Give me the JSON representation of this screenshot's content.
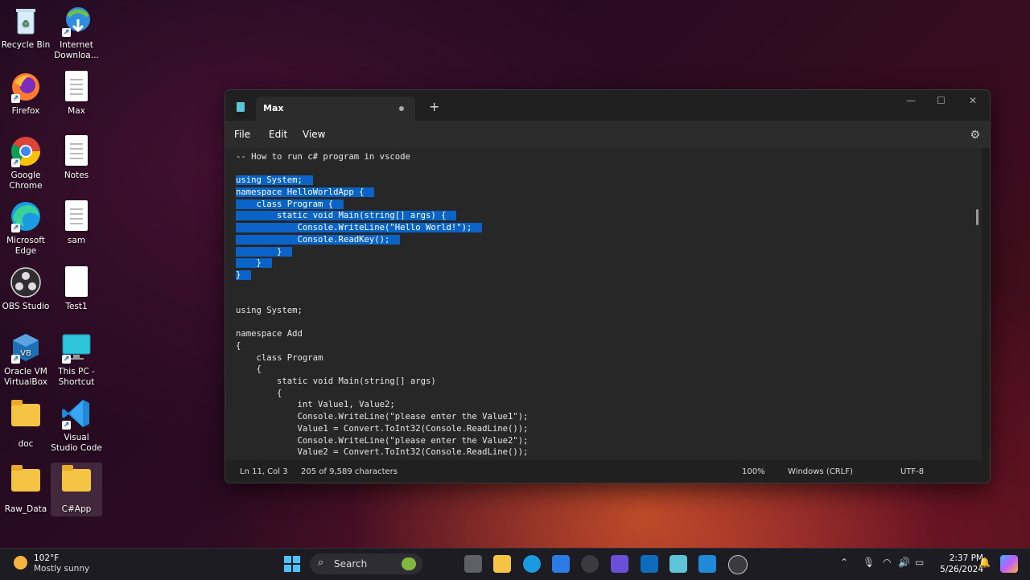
{
  "desktop": {
    "icons": [
      {
        "label": "Recycle Bin"
      },
      {
        "label": "Internet Downloa..."
      },
      {
        "label": "Firefox"
      },
      {
        "label": "Max"
      },
      {
        "label": "Google Chrome"
      },
      {
        "label": "Notes"
      },
      {
        "label": "Microsoft Edge"
      },
      {
        "label": "sam"
      },
      {
        "label": "OBS Studio"
      },
      {
        "label": "Test1"
      },
      {
        "label": "Oracle VM VirtualBox"
      },
      {
        "label": "This PC - Shortcut"
      },
      {
        "label": "doc"
      },
      {
        "label": "Visual Studio Code"
      },
      {
        "label": "Raw_Data"
      },
      {
        "label": "C#App"
      }
    ]
  },
  "notepad": {
    "tab_title": "Max",
    "new_tab": "+",
    "menu": {
      "file": "File",
      "edit": "Edit",
      "view": "View"
    },
    "lines": [
      "-- How to run c# program in vscode",
      "",
      "using System;",
      "namespace HelloWorldApp {",
      "    class Program {",
      "        static void Main(string[] args) {",
      "            Console.WriteLine(\"Hello World!\");",
      "            Console.ReadKey();",
      "        }",
      "    }",
      "}",
      "",
      "",
      "using System;",
      "",
      "namespace Add",
      "{",
      "    class Program",
      "    {",
      "        static void Main(string[] args)",
      "        {",
      "            int Value1, Value2;",
      "            Console.WriteLine(\"please enter the Value1\");",
      "            Value1 = Convert.ToInt32(Console.ReadLine());",
      "            Console.WriteLine(\"please enter the Value2\");",
      "            Value2 = Convert.ToInt32(Console.ReadLine());"
    ],
    "selected_lines": [
      2,
      3,
      4,
      5,
      6,
      7,
      8,
      9,
      10
    ],
    "status": {
      "position": "Ln 11, Col 3",
      "chars": "205 of 9,589 characters",
      "zoom": "100%",
      "line_ending": "Windows (CRLF)",
      "encoding": "UTF-8"
    }
  },
  "taskbar": {
    "weather_temp": "102°F",
    "weather_desc": "Mostly sunny",
    "search_label": "Search",
    "time": "2:37 PM",
    "date": "5/26/2024"
  },
  "colors": {
    "selection": "#0a64c8",
    "accent": "#3a8ee6"
  }
}
